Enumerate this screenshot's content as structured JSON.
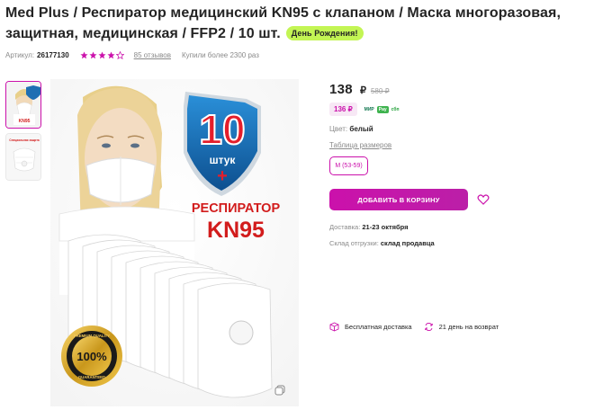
{
  "product": {
    "title": "Med Plus / Респиратор медицинский KN95 с клапаном / Маска многоразовая, защитная, медицинская / FFP2 / 10 шт.",
    "promo_badge": "День Рождения!",
    "article_label": "Артикул:",
    "article_value": "26177130",
    "rating": 4,
    "rating_max": 5,
    "reviews": "85 отзывов",
    "bought": "Купили более 2300 раз"
  },
  "gallery": {
    "image_texts": {
      "count": "10",
      "unit": "штук",
      "plus": "+",
      "heading": "РЕСПИРАТОР",
      "model": "KN95",
      "seal_top": "PREMIUM QUALITY",
      "seal_center": "100%",
      "seal_bottom": "GUARANTEED"
    },
    "thumb_model": "KN95",
    "thumb2_caption": "Специальная защита"
  },
  "price": {
    "current": "138",
    "currency": "₽",
    "old": "580 ₽",
    "wallet": "136 ₽",
    "pay_logos": [
      "МИР",
      "Pay",
      "сбп"
    ]
  },
  "options": {
    "color_label": "Цвет:",
    "color_value": "белый",
    "size_table_link": "Таблица размеров",
    "size_selected": "M (53-59)"
  },
  "actions": {
    "add_to_cart": "ДОБАВИТЬ В КОРЗИНУ"
  },
  "delivery": {
    "label": "Доставка:",
    "value": "21-23 октября",
    "warehouse_label": "Склад отгрузки:",
    "warehouse_value": "склад продавца"
  },
  "perks": {
    "free_delivery": "Бесплатная доставка",
    "return": "21 день на возврат"
  },
  "colors": {
    "accent": "#cb11ab",
    "badge": "#c3f554",
    "star_filled": "#cb11ab",
    "star_empty": "#cb11ab"
  }
}
